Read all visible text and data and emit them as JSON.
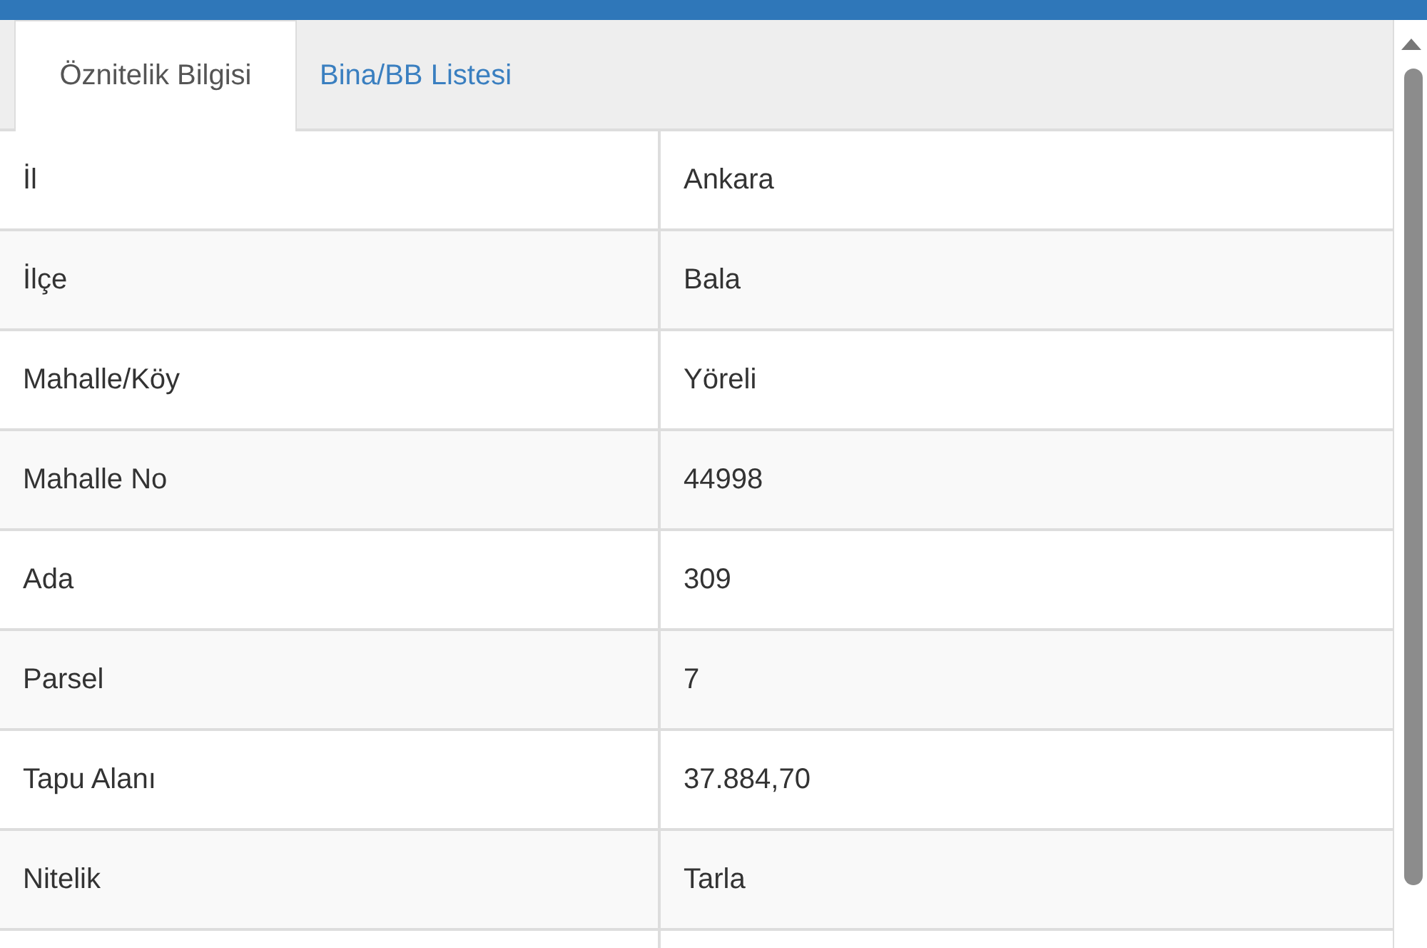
{
  "tabs": [
    {
      "label": "Öznitelik Bilgisi",
      "selected": true
    },
    {
      "label": "Bina/BB Listesi",
      "selected": false
    }
  ],
  "table": {
    "rows": [
      {
        "label": "İl",
        "value": "Ankara"
      },
      {
        "label": "İlçe",
        "value": "Bala"
      },
      {
        "label": "Mahalle/Köy",
        "value": "Yöreli"
      },
      {
        "label": "Mahalle No",
        "value": "44998"
      },
      {
        "label": "Ada",
        "value": "309"
      },
      {
        "label": "Parsel",
        "value": "7"
      },
      {
        "label": "Tapu Alanı",
        "value": "37.884,70"
      },
      {
        "label": "Nitelik",
        "value": "Tarla"
      }
    ]
  }
}
